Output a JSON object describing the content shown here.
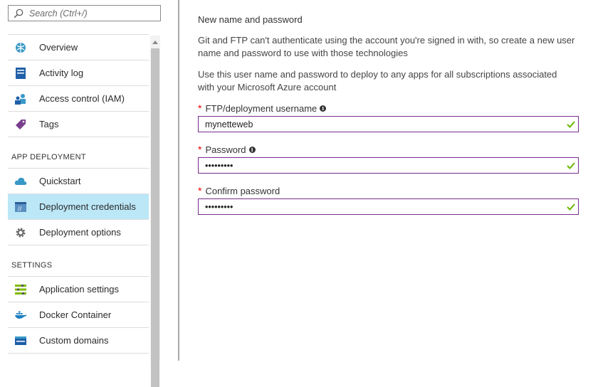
{
  "search": {
    "placeholder": "Search (Ctrl+/)"
  },
  "sidebar": {
    "items": [
      {
        "label": "Overview"
      },
      {
        "label": "Activity log"
      },
      {
        "label": "Access control (IAM)"
      },
      {
        "label": "Tags"
      }
    ],
    "sections": [
      {
        "title": "APP DEPLOYMENT",
        "items": [
          {
            "label": "Quickstart"
          },
          {
            "label": "Deployment credentials",
            "selected": true
          },
          {
            "label": "Deployment options"
          }
        ]
      },
      {
        "title": "SETTINGS",
        "items": [
          {
            "label": "Application settings"
          },
          {
            "label": "Docker Container"
          },
          {
            "label": "Custom domains"
          }
        ]
      }
    ]
  },
  "main": {
    "heading": "New name and password",
    "para1": "Git and FTP can't authenticate using the account you're signed in with, so create a new user name and password to use with those technologies",
    "para2": "Use this user name and password to deploy to any apps for all subscriptions associated with your Microsoft Azure account",
    "fields": [
      {
        "label": "FTP/deployment username",
        "value": "mynetteweb",
        "required": true,
        "info": true
      },
      {
        "label": "Password",
        "value": "•••••••••",
        "required": true,
        "info": true
      },
      {
        "label": "Confirm password",
        "value": "•••••••••",
        "required": true,
        "info": false
      }
    ]
  },
  "colors": {
    "selected_bg": "#bbe7f7",
    "field_border": "#7a2d8c",
    "check": "#6bb700",
    "required": "#e00000"
  }
}
